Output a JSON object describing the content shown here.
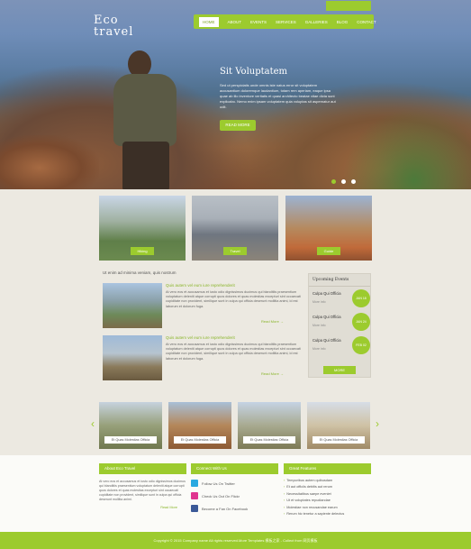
{
  "brand": {
    "line1": "Eco",
    "line2": "travel"
  },
  "top_button": "",
  "nav": [
    "HOME",
    "ABOUT",
    "EVENTS",
    "SERVICES",
    "GALLERIES",
    "BLOG",
    "CONTACT"
  ],
  "hero": {
    "title": "Sit Voluptatem",
    "text": "Sed ut perspiciatis unde omnis iste natus error sit voluptatem accusantium doloremque laudantium, totam rem aperiam, eaque ipsa quae ab illo inventore veritatis et quasi architecto beatae vitae dicta sunt explicabo. Nemo enim ipsam voluptatem quia voluptas sit aspernatur aut odit.",
    "button": "READ MORE"
  },
  "thumbs": [
    "Hiking",
    "Travel",
    "Guide"
  ],
  "intro": "Ut enim ad minima veniam, quis nostrum",
  "articles": [
    {
      "title": "Quis autem vel eum iure reprehenderit",
      "text": "At vero eos et accusamus et iusto odio dignissimos ducimus qui blanditiis praesentium voluptatum deleniti atque corrupti quos dolores et quas molestias excepturi sint occaecati cupiditate non provident, similique sunt in culpa qui officia deserunt mollitia animi, id est laborum et dolorum fuga.",
      "more": "Read More"
    },
    {
      "title": "Quis autem vel eum iure reprehenderit",
      "text": "At vero eos et accusamus et iusto odio dignissimos ducimus qui blanditiis praesentium voluptatum deleniti atque corrupti quos dolores et quas molestias excepturi sint occaecati cupiditate non provident, similique sunt in culpa qui officia deserunt mollitia animi, id est laborum et dolorum fuga.",
      "more": "Read More"
    }
  ],
  "events": {
    "title": "Upcoming Events",
    "items": [
      {
        "title": "Culpa Qui Officia",
        "meta": "More info",
        "date": "JAN 18"
      },
      {
        "title": "Culpa Qui Officia",
        "meta": "More info",
        "date": "JAN 24"
      },
      {
        "title": "Culpa Qui Officia",
        "meta": "More info",
        "date": "FEB 02"
      }
    ],
    "button": "MORE"
  },
  "gallery": [
    "Et Quas Molestias Officia",
    "Et Quas Molestias Officia",
    "Et Quas Molestias Officia",
    "Et Quas Molestias Officia"
  ],
  "footer": {
    "about": {
      "title": "About Eco Travel",
      "text": "At vero eos et accusamus et iusto odio dignissimos ducimus qui blanditiis praesentium voluptatum deleniti atque corrupti quos dolores et quas molestias excepturi sint occaecati cupiditate non provident, similique sunt in culpa qui officia deserunt mollitia animi.",
      "more": "Read More"
    },
    "connect": {
      "title": "Connect With Us",
      "items": [
        {
          "label": "Follow Us On Twitter",
          "color": "#2aa9e0"
        },
        {
          "label": "Check Us Out On Flickr",
          "color": "#e0348f"
        },
        {
          "label": "Become a Fan On Facebook",
          "color": "#3b5998"
        }
      ]
    },
    "features": {
      "title": "Great Features",
      "items": [
        "Temporibus autem quibusdam",
        "Et aut officiis debitis aut rerum",
        "Necessitatibus saepe eveniet",
        "Ut et voluptates repudiandae",
        "Molestiae non recusandae earum",
        "Rerum hic tenetur a sapiente delectus"
      ]
    }
  },
  "copyright": "Copyright © 2015 Company name All rights reserved.More Templates 模板之家 - Collect from 网页模板"
}
